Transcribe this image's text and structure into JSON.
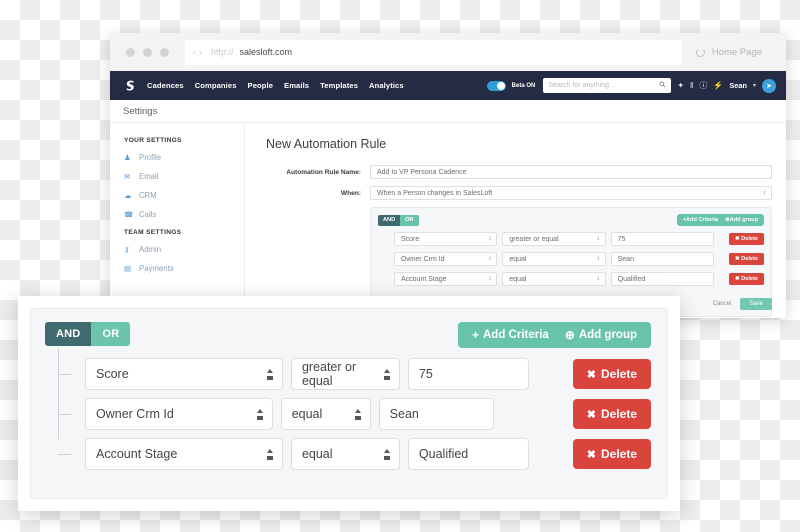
{
  "browser": {
    "url_protocol": "http://",
    "url_host": "salesloft.com",
    "nav_back": "‹",
    "nav_forward": "›",
    "home_page_label": "Home Page",
    "reload_icon": "reload-icon"
  },
  "appnav": {
    "logo": "salesloft-logo",
    "links": [
      {
        "label": "Cadences"
      },
      {
        "label": "Companies"
      },
      {
        "label": "People"
      },
      {
        "label": "Emails"
      },
      {
        "label": "Templates"
      },
      {
        "label": "Analytics"
      }
    ],
    "beta_label": "Beta ON",
    "search_placeholder": "Search for anything...",
    "search_icon": "○",
    "icons": [
      {
        "name": "sparkle-icon",
        "glyph": "✦"
      },
      {
        "name": "bars-icon",
        "glyph": "‖"
      },
      {
        "name": "info-icon",
        "glyph": "ⓘ"
      },
      {
        "name": "bolt-icon",
        "glyph": "⚡"
      }
    ],
    "user_name": "Sean",
    "caret": "▾",
    "avatar_glyph": "➤"
  },
  "settings_tab": {
    "label": "Settings"
  },
  "sidebar": {
    "group_1_title": "YOUR SETTINGS",
    "group_1_items": [
      {
        "label": "Profile",
        "icon": "user-icon",
        "glyph": "♟"
      },
      {
        "label": "Email",
        "icon": "envelope-icon",
        "glyph": "✉"
      },
      {
        "label": "CRM",
        "icon": "cloud-icon",
        "glyph": "☁"
      },
      {
        "label": "Calls",
        "icon": "phone-icon",
        "glyph": "☎"
      }
    ],
    "group_2_title": "TEAM SETTINGS",
    "group_2_items": [
      {
        "label": "Admin",
        "icon": "key-icon",
        "glyph": "⚷"
      },
      {
        "label": "Payments",
        "icon": "card-icon",
        "glyph": "▤"
      }
    ]
  },
  "main": {
    "title": "New Automation Rule",
    "rule_name_label": "Automation Rule Name:",
    "rule_name_value": "Add to VP Persona Cadence",
    "when_label": "When:",
    "when_value": "When a Person changes in SalesLoft",
    "and_label": "AND",
    "or_label": "OR",
    "add_criteria_label": "Add Criteria",
    "add_group_label": "Add group",
    "add_criteria_icon": "+",
    "add_group_icon": "⊕",
    "delete_label": "Delete",
    "delete_icon": "✖",
    "criteria": [
      {
        "attribute": "Score",
        "operator": "greater or equal",
        "value": "75"
      },
      {
        "attribute": "Owner Crm Id",
        "operator": "equal",
        "value": "Sean"
      },
      {
        "attribute": "Account Stage",
        "operator": "equal",
        "value": "Qualified"
      }
    ],
    "cancel_label": "Cancel",
    "save_label": "Save"
  },
  "foreground": {
    "and_label": "AND",
    "or_label": "OR",
    "add_criteria_label": "Add Criteria",
    "add_group_label": "Add group",
    "add_criteria_icon": "+",
    "add_group_icon": "⊕",
    "delete_label": "Delete",
    "delete_icon": "✖",
    "criteria": [
      {
        "attribute": "Score",
        "operator": "greater or equal",
        "value": "75"
      },
      {
        "attribute": "Owner Crm Id",
        "operator": "equal",
        "value": "Sean"
      },
      {
        "attribute": "Account Stage",
        "operator": "equal",
        "value": "Qualified"
      }
    ]
  },
  "colors": {
    "nav_dark": "#262b44",
    "accent_green": "#68c3ab",
    "and_teal": "#3f6b6e",
    "delete_red": "#d9443c",
    "link_blue": "#5b9bd5"
  }
}
